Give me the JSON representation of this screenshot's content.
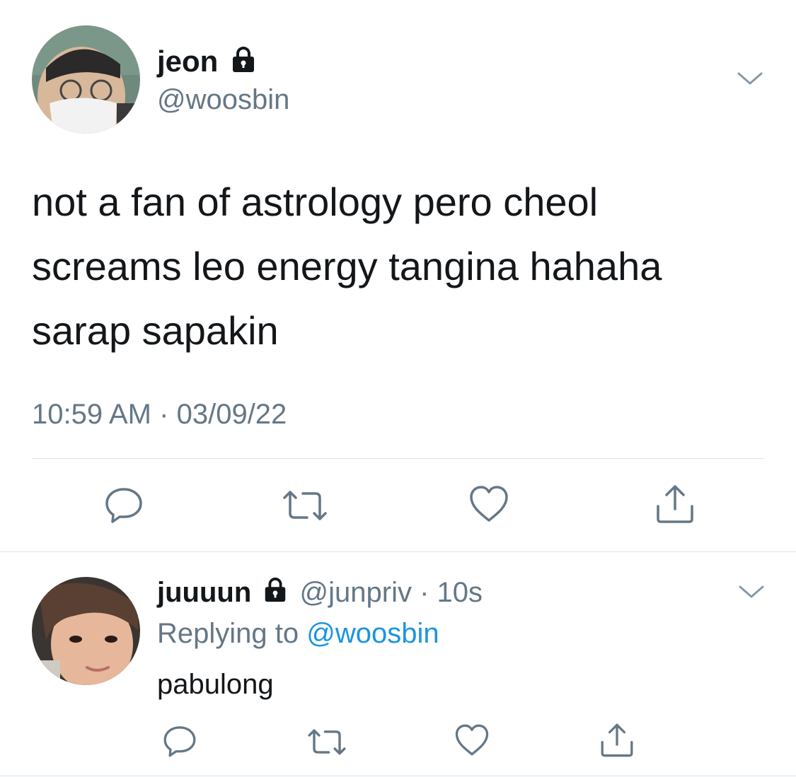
{
  "main_tweet": {
    "display_name": "jeon",
    "handle": "@woosbin",
    "text_lines": [
      "not a fan of astrology pero cheol",
      "screams leo energy tangina hahaha",
      "sarap sapakin"
    ],
    "time": "10:59 AM",
    "separator": "·",
    "date": "03/09/22",
    "icons": [
      "lock-icon",
      "chevron-down-icon",
      "reply-icon",
      "retweet-icon",
      "like-icon",
      "share-icon"
    ]
  },
  "reply_tweet": {
    "display_name": "juuuun",
    "handle": "@junpriv",
    "separator": "·",
    "age": "10s",
    "replying_prefix": "Replying to",
    "replying_handle": "@woosbin",
    "text": "pabulong",
    "icons": [
      "lock-icon",
      "chevron-down-icon",
      "reply-icon",
      "retweet-icon",
      "like-icon",
      "share-icon"
    ]
  },
  "colors": {
    "text": "#14171a",
    "secondary": "#657786",
    "link": "#1b95e0",
    "icon": "#657786",
    "divider": "#dfe3e6"
  }
}
